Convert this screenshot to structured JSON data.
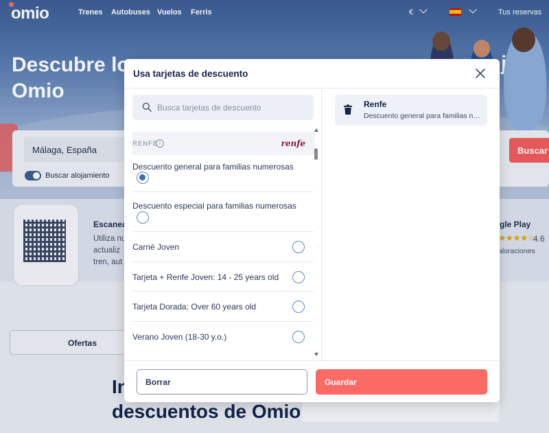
{
  "nav": {
    "logo": "omio",
    "links": [
      "Trenes",
      "Autobuses",
      "Vuelos",
      "Ferris"
    ],
    "currency": "€",
    "bookings": "Tus reservas"
  },
  "hero": {
    "headline_line1": "Descubre lo",
    "headline_line2": "Omio",
    "headline_right": "jes"
  },
  "search": {
    "origin": "Málaga, España",
    "toggle_label": "Buscar alojamiento",
    "button": "Buscar"
  },
  "promo": {
    "title": "Escanea",
    "text_lines": [
      "Utiliza nu",
      "actualiz",
      "tren, aut"
    ],
    "store_title": "gle Play",
    "stars": "★★★★☆",
    "rating": "4.6",
    "store_sub": "aloraciones"
  },
  "tabs": {
    "offers": "Ofertas"
  },
  "bottom": {
    "heading_line1": "In",
    "heading_line2": "descuentos de Omio"
  },
  "modal": {
    "title": "Usa tarjetas de descuento",
    "search_placeholder": "Busca tarjetas de descuento",
    "group": {
      "name": "RENFE",
      "brand": "renfe"
    },
    "options": [
      {
        "label": "Descuento general para familias numerosas",
        "checked": true
      },
      {
        "label": "Descuento especial para familias numerosas",
        "checked": false
      },
      {
        "label": "Carné Joven",
        "checked": false
      },
      {
        "label": "Tarjeta + Renfe Joven: 14 - 25 years old",
        "checked": false
      },
      {
        "label": "Tarjeta Dorada: Over 60 years old",
        "checked": false
      },
      {
        "label": "Verano Joven (18-30 y.o.)",
        "checked": false
      }
    ],
    "selected": {
      "title": "Renfe",
      "subtitle": "Descuento general para familias numerosas"
    },
    "buttons": {
      "clear": "Borrar",
      "save": "Guardar"
    }
  },
  "colors": {
    "brand_coral": "#fc6a66",
    "navy": "#132349",
    "radio_blue": "#3b6fb7",
    "renfe": "#8a1538"
  }
}
